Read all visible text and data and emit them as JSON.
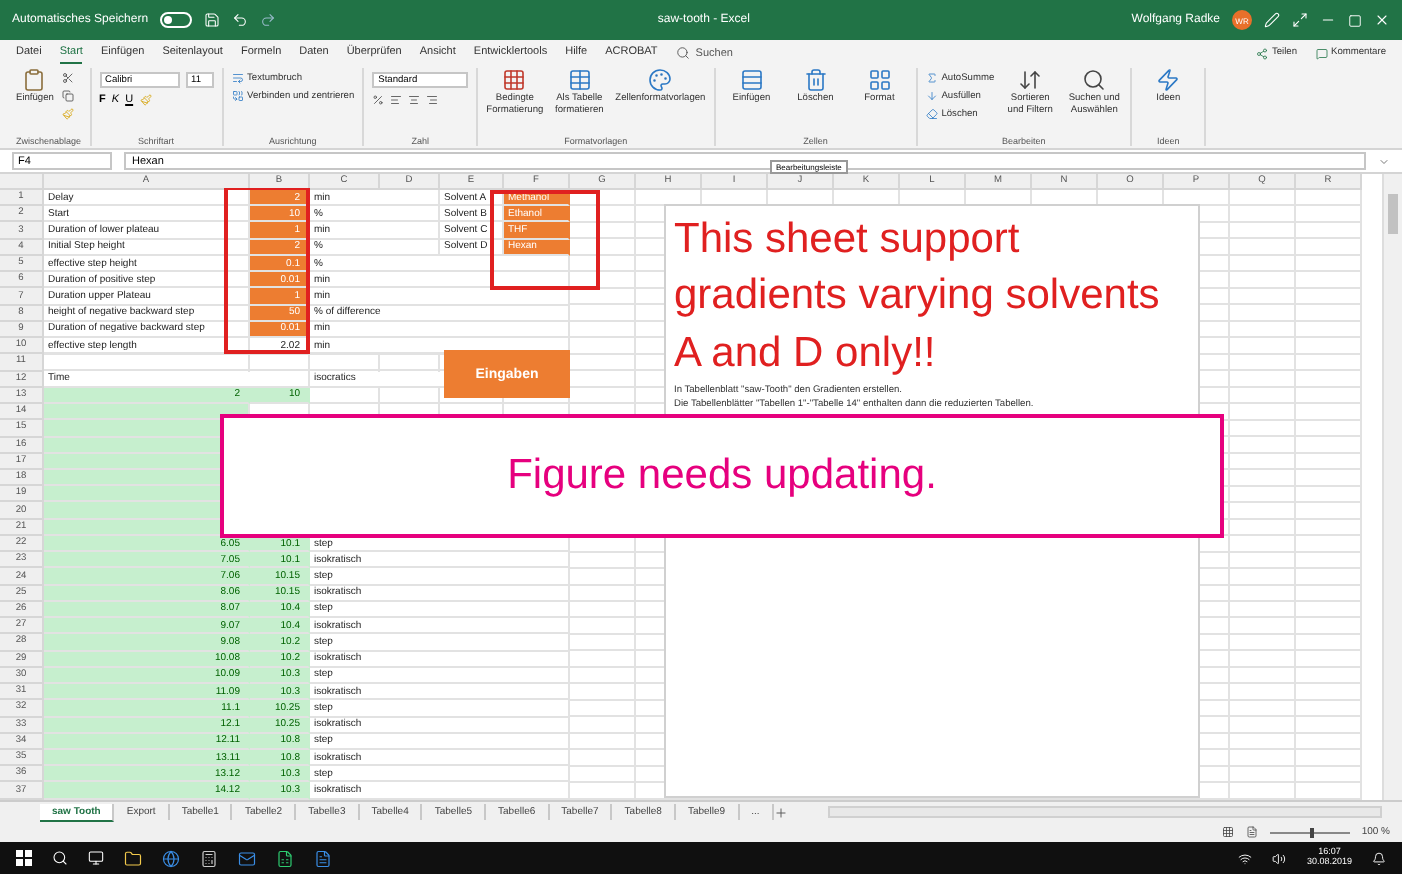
{
  "title_bar": {
    "autosave_label": "Automatisches Speichern",
    "autosave_on": false,
    "title": "saw-tooth - Excel",
    "user": "Wolfgang Radke",
    "avatar_initials": "WR"
  },
  "menu_tabs": [
    {
      "label": "Datei",
      "selected": false
    },
    {
      "label": "Start",
      "selected": true
    },
    {
      "label": "Einfügen",
      "selected": false
    },
    {
      "label": "Seitenlayout",
      "selected": false
    },
    {
      "label": "Formeln",
      "selected": false
    },
    {
      "label": "Daten",
      "selected": false
    },
    {
      "label": "Überprüfen",
      "selected": false
    },
    {
      "label": "Ansicht",
      "selected": false
    },
    {
      "label": "Entwicklertools",
      "selected": false
    },
    {
      "label": "Hilfe",
      "selected": false
    },
    {
      "label": "ACROBAT",
      "selected": false
    }
  ],
  "search": {
    "placeholder": "Suchen"
  },
  "share": "Teilen",
  "comments": "Kommentare",
  "ribbon": [
    {
      "label": "Zwischenablage",
      "items": [
        {
          "kind": "large",
          "label": "Einfügen"
        },
        {
          "kind": "cliptools"
        }
      ]
    },
    {
      "label": "Schriftart",
      "items": [
        {
          "kind": "stack",
          "items": [
            {
              "kind": "fontrow",
              "font": "Calibri",
              "size": "11"
            },
            {
              "kind": "glyphs",
              "glyphs": [
                "F",
                "K",
                "U"
              ]
            }
          ]
        }
      ]
    },
    {
      "label": "Ausrichtung",
      "items": [
        {
          "kind": "stack",
          "items": [
            {
              "kind": "small",
              "label": "Textumbruch"
            },
            {
              "kind": "small",
              "label": "Verbinden und zentrieren"
            }
          ]
        }
      ]
    },
    {
      "label": "Zahl",
      "items": [
        {
          "kind": "stack",
          "items": [
            {
              "kind": "field",
              "value": "Standard"
            },
            {
              "kind": "numtools"
            }
          ]
        }
      ]
    },
    {
      "label": "Formatvorlagen",
      "items": [
        {
          "kind": "large",
          "label": "Bedingte Formatierung"
        },
        {
          "kind": "large",
          "label": "Als Tabelle formatieren"
        },
        {
          "kind": "large",
          "label": "Zellenformatvorlagen"
        }
      ]
    },
    {
      "label": "Zellen",
      "items": [
        {
          "kind": "large",
          "label": "Einfügen"
        },
        {
          "kind": "large",
          "label": "Löschen"
        },
        {
          "kind": "large",
          "label": "Format"
        }
      ]
    },
    {
      "label": "Bearbeiten",
      "items": [
        {
          "kind": "stack",
          "items": [
            {
              "kind": "small",
              "label": "AutoSumme"
            },
            {
              "kind": "small",
              "label": "Ausfüllen"
            },
            {
              "kind": "small",
              "label": "Löschen"
            }
          ]
        },
        {
          "kind": "large",
          "label": "Sortieren und Filtern"
        },
        {
          "kind": "large",
          "label": "Suchen und Auswählen"
        }
      ]
    },
    {
      "label": "Ideen",
      "items": [
        {
          "kind": "large",
          "label": "Ideen"
        }
      ]
    }
  ],
  "formula_bar": {
    "name_box": "F4",
    "value": "Hexan"
  },
  "tooltip": "Bearbeitungsleiste",
  "columns": [
    "A",
    "B",
    "C",
    "D",
    "E",
    "F",
    "G",
    "H",
    "I",
    "J",
    "K",
    "L",
    "M",
    "N",
    "O",
    "P",
    "Q",
    "R"
  ],
  "rows": [
    {
      "number": "1",
      "cells": {
        "A": {
          "kind": "text",
          "text": "Delay"
        },
        "B": {
          "kind": "number",
          "text": "2",
          "color": "#ed7d31"
        },
        "C": {
          "kind": "text",
          "text": "min"
        },
        "E": {
          "kind": "text",
          "text": "Solvent A"
        },
        "F": {
          "kind": "text",
          "text": "Methanol",
          "color": "#ed7d31"
        }
      }
    },
    {
      "number": "2",
      "cells": {
        "A": {
          "kind": "text",
          "text": "Start"
        },
        "B": {
          "kind": "number",
          "text": "10",
          "color": "#ed7d31"
        },
        "C": {
          "kind": "text",
          "text": "%"
        },
        "E": {
          "kind": "text",
          "text": "Solvent B"
        },
        "F": {
          "kind": "text",
          "text": "Ethanol",
          "color": "#ed7d31"
        }
      }
    },
    {
      "number": "3",
      "cells": {
        "A": {
          "kind": "text",
          "text": "Duration of lower plateau"
        },
        "B": {
          "kind": "number",
          "text": "1",
          "color": "#ed7d31"
        },
        "C": {
          "kind": "text",
          "text": "min"
        },
        "E": {
          "kind": "text",
          "text": "Solvent C"
        },
        "F": {
          "kind": "text",
          "text": "THF",
          "color": "#ed7d31"
        }
      }
    },
    {
      "number": "4",
      "cells": {
        "A": {
          "kind": "text",
          "text": "Initial Step height"
        },
        "B": {
          "kind": "number",
          "text": "2",
          "color": "#ed7d31"
        },
        "C": {
          "kind": "text",
          "text": "%"
        },
        "E": {
          "kind": "text",
          "text": "Solvent D"
        },
        "F": {
          "kind": "text",
          "text": "Hexan",
          "color": "#ed7d31"
        }
      }
    },
    {
      "number": "5",
      "cells": {
        "A": {
          "kind": "text",
          "text": "effective step height"
        },
        "B": {
          "kind": "number",
          "text": "0.1",
          "color": "#ed7d31"
        },
        "C": {
          "kind": "text",
          "text": "%"
        }
      }
    },
    {
      "number": "6",
      "cells": {
        "A": {
          "kind": "text",
          "text": "Duration of positive step"
        },
        "B": {
          "kind": "number",
          "text": "0.01",
          "color": "#ed7d31"
        },
        "C": {
          "kind": "text",
          "text": "min"
        }
      }
    },
    {
      "number": "7",
      "cells": {
        "A": {
          "kind": "text",
          "text": "Duration upper Plateau"
        },
        "B": {
          "kind": "number",
          "text": "1",
          "color": "#ed7d31"
        },
        "C": {
          "kind": "text",
          "text": "min"
        }
      }
    },
    {
      "number": "8",
      "cells": {
        "A": {
          "kind": "text",
          "text": "height of negative backward step"
        },
        "B": {
          "kind": "number",
          "text": "50",
          "color": "#ed7d31"
        },
        "C": {
          "kind": "text",
          "text": "% of difference"
        }
      }
    },
    {
      "number": "9",
      "cells": {
        "A": {
          "kind": "text",
          "text": "Duration of negative backward step"
        },
        "B": {
          "kind": "number",
          "text": "0.01",
          "color": "#ed7d31"
        },
        "C": {
          "kind": "text",
          "text": "min"
        }
      }
    },
    {
      "number": "10",
      "cells": {
        "A": {
          "kind": "text",
          "text": "effective step length"
        },
        "B": {
          "kind": "number",
          "text": "2.02"
        },
        "C": {
          "kind": "text",
          "text": "min"
        }
      }
    },
    {
      "number": "11",
      "cells": {}
    },
    {
      "number": "12",
      "cells": {
        "A": {
          "kind": "text",
          "text": "Time"
        },
        "C": {
          "kind": "text",
          "text": "isocratics"
        }
      }
    },
    {
      "number": "13",
      "cells": {
        "A": {
          "kind": "number",
          "text": "2",
          "color": "#c6efce"
        },
        "B": {
          "kind": "number",
          "text": "10",
          "color": "#c6efce"
        }
      }
    },
    {
      "number": "14",
      "cells": {
        "A": {
          "color": "#c6efce"
        }
      }
    },
    {
      "number": "15",
      "cells": {
        "A": {
          "color": "#c6efce"
        }
      }
    },
    {
      "number": "16",
      "cells": {
        "A": {
          "color": "#c6efce"
        }
      }
    },
    {
      "number": "17",
      "cells": {
        "A": {
          "color": "#c6efce"
        }
      }
    },
    {
      "number": "18",
      "cells": {
        "A": {
          "color": "#c6efce"
        }
      }
    },
    {
      "number": "19",
      "cells": {
        "A": {
          "color": "#c6efce"
        }
      }
    },
    {
      "number": "20",
      "cells": {
        "A": {
          "color": "#c6efce"
        }
      }
    },
    {
      "number": "21",
      "cells": {
        "A": {
          "color": "#c6efce"
        }
      }
    },
    {
      "number": "22",
      "cells": {
        "A": {
          "kind": "number",
          "text": "6.05",
          "color": "#c6efce"
        },
        "B": {
          "kind": "number",
          "text": "10.1",
          "color": "#c6efce"
        },
        "C": {
          "kind": "text",
          "text": "step"
        }
      }
    },
    {
      "number": "23",
      "cells": {
        "A": {
          "kind": "number",
          "text": "7.05",
          "color": "#c6efce"
        },
        "B": {
          "kind": "number",
          "text": "10.1",
          "color": "#c6efce"
        },
        "C": {
          "kind": "text",
          "text": "isokratisch"
        }
      }
    },
    {
      "number": "24",
      "cells": {
        "A": {
          "kind": "number",
          "text": "7.06",
          "color": "#c6efce"
        },
        "B": {
          "kind": "number",
          "text": "10.15",
          "color": "#c6efce"
        },
        "C": {
          "kind": "text",
          "text": "step"
        }
      }
    },
    {
      "number": "25",
      "cells": {
        "A": {
          "kind": "number",
          "text": "8.06",
          "color": "#c6efce"
        },
        "B": {
          "kind": "number",
          "text": "10.15",
          "color": "#c6efce"
        },
        "C": {
          "kind": "text",
          "text": "isokratisch"
        }
      }
    },
    {
      "number": "26",
      "cells": {
        "A": {
          "kind": "number",
          "text": "8.07",
          "color": "#c6efce"
        },
        "B": {
          "kind": "number",
          "text": "10.4",
          "color": "#c6efce"
        },
        "C": {
          "kind": "text",
          "text": "step"
        }
      }
    },
    {
      "number": "27",
      "cells": {
        "A": {
          "kind": "number",
          "text": "9.07",
          "color": "#c6efce"
        },
        "B": {
          "kind": "number",
          "text": "10.4",
          "color": "#c6efce"
        },
        "C": {
          "kind": "text",
          "text": "isokratisch"
        }
      }
    },
    {
      "number": "28",
      "cells": {
        "A": {
          "kind": "number",
          "text": "9.08",
          "color": "#c6efce"
        },
        "B": {
          "kind": "number",
          "text": "10.2",
          "color": "#c6efce"
        },
        "C": {
          "kind": "text",
          "text": "step"
        }
      }
    },
    {
      "number": "29",
      "cells": {
        "A": {
          "kind": "number",
          "text": "10.08",
          "color": "#c6efce"
        },
        "B": {
          "kind": "number",
          "text": "10.2",
          "color": "#c6efce"
        },
        "C": {
          "kind": "text",
          "text": "isokratisch"
        }
      }
    },
    {
      "number": "30",
      "cells": {
        "A": {
          "kind": "number",
          "text": "10.09",
          "color": "#c6efce"
        },
        "B": {
          "kind": "number",
          "text": "10.3",
          "color": "#c6efce"
        },
        "C": {
          "kind": "text",
          "text": "step"
        }
      }
    },
    {
      "number": "31",
      "cells": {
        "A": {
          "kind": "number",
          "text": "11.09",
          "color": "#c6efce"
        },
        "B": {
          "kind": "number",
          "text": "10.3",
          "color": "#c6efce"
        },
        "C": {
          "kind": "text",
          "text": "isokratisch"
        }
      }
    },
    {
      "number": "32",
      "cells": {
        "A": {
          "kind": "number",
          "text": "11.1",
          "color": "#c6efce"
        },
        "B": {
          "kind": "number",
          "text": "10.25",
          "color": "#c6efce"
        },
        "C": {
          "kind": "text",
          "text": "step"
        }
      }
    },
    {
      "number": "33",
      "cells": {
        "A": {
          "kind": "number",
          "text": "12.1",
          "color": "#c6efce"
        },
        "B": {
          "kind": "number",
          "text": "10.25",
          "color": "#c6efce"
        },
        "C": {
          "kind": "text",
          "text": "isokratisch"
        }
      }
    },
    {
      "number": "34",
      "cells": {
        "A": {
          "kind": "number",
          "text": "12.11",
          "color": "#c6efce"
        },
        "B": {
          "kind": "number",
          "text": "10.8",
          "color": "#c6efce"
        },
        "C": {
          "kind": "text",
          "text": "step"
        }
      }
    },
    {
      "number": "35",
      "cells": {
        "A": {
          "kind": "number",
          "text": "13.11",
          "color": "#c6efce"
        },
        "B": {
          "kind": "number",
          "text": "10.8",
          "color": "#c6efce"
        },
        "C": {
          "kind": "text",
          "text": "isokratisch"
        }
      }
    },
    {
      "number": "36",
      "cells": {
        "A": {
          "kind": "number",
          "text": "13.12",
          "color": "#c6efce"
        },
        "B": {
          "kind": "number",
          "text": "10.3",
          "color": "#c6efce"
        },
        "C": {
          "kind": "text",
          "text": "step"
        }
      }
    },
    {
      "number": "37",
      "cells": {
        "A": {
          "kind": "number",
          "text": "14.12",
          "color": "#c6efce"
        },
        "B": {
          "kind": "number",
          "text": "10.3",
          "color": "#c6efce"
        },
        "C": {
          "kind": "text",
          "text": "isokratisch"
        }
      }
    }
  ],
  "text_box": {
    "heading": "This sheet support gradients varying solvents A and D only!!",
    "lines": [
      "In Tabellenblatt \"saw-Tooth\" den Gradienten erstellen.",
      "Die Tabellenblätter \"Tabellen 1\"-\"Tabelle 14\" enthalten dann die reduzierten Tabellen."
    ]
  },
  "input_button": "Eingaben",
  "banner": "Figure needs updating.",
  "sheet_tabs": [
    {
      "label": "saw Tooth",
      "selected": true
    },
    {
      "label": "Export",
      "selected": false
    },
    {
      "label": "Tabelle1",
      "selected": false
    },
    {
      "label": "Tabelle2",
      "selected": false
    },
    {
      "label": "Tabelle3",
      "selected": false
    },
    {
      "label": "Tabelle4",
      "selected": false
    },
    {
      "label": "Tabelle5",
      "selected": false
    },
    {
      "label": "Tabelle6",
      "selected": false
    },
    {
      "label": "Tabelle7",
      "selected": false
    },
    {
      "label": "Tabelle8",
      "selected": false
    },
    {
      "label": "Tabelle9",
      "selected": false
    }
  ],
  "more_tabs": "...",
  "status_bar": {
    "zoom": {
      "level": 0.5
    },
    "zoom_label": "100 %"
  },
  "taskbar": {
    "time": "16:07",
    "date": "30.08.2019"
  }
}
